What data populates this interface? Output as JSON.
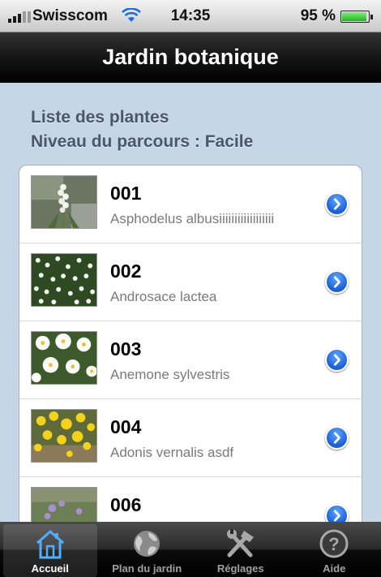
{
  "status_bar": {
    "carrier": "Swisscom",
    "time": "14:35",
    "battery": "95 %",
    "battery_level": 0.95
  },
  "nav_bar": {
    "title": "Jardin botanique"
  },
  "section": {
    "line1": "Liste des plantes",
    "line2": "Niveau du parcours : Facile"
  },
  "plants": [
    {
      "number": "001",
      "name": "Asphodelus albusiiiiiiiiiiiiiiiiii",
      "thumb": "white-flower-spike"
    },
    {
      "number": "002",
      "name": "Androsace lactea",
      "thumb": "small-white-flowers"
    },
    {
      "number": "003",
      "name": "Anemone sylvestris",
      "thumb": "white-anemones"
    },
    {
      "number": "004",
      "name": "Adonis vernalis asdf",
      "thumb": "yellow-flowers"
    },
    {
      "number": "006",
      "name": "",
      "thumb": "purple-flowers"
    }
  ],
  "tab_bar": {
    "tabs": [
      {
        "label": "Accueil",
        "icon": "home-icon",
        "active": true
      },
      {
        "label": "Plan du jardin",
        "icon": "globe-icon",
        "active": false
      },
      {
        "label": "Réglages",
        "icon": "tools-icon",
        "active": false
      },
      {
        "label": "Aide",
        "icon": "help-icon",
        "active": false
      }
    ]
  },
  "colors": {
    "background": "#c5d6e4",
    "section_text": "#4c566a",
    "accent_blue": "#1a5fd6"
  }
}
